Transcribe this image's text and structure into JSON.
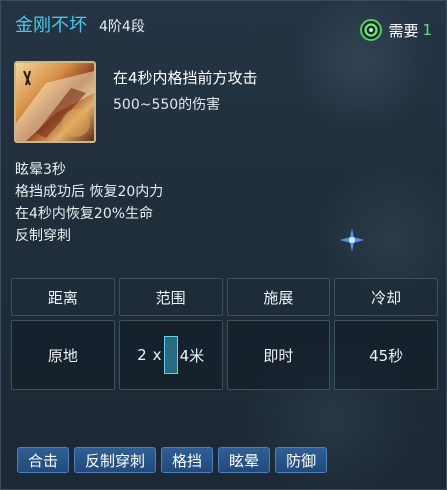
{
  "header": {
    "title": "金刚不坏",
    "stage": "4阶4段",
    "requirement_label": "需要",
    "requirement_value": "1"
  },
  "skill": {
    "icon": "skill-icon",
    "description": "在4秒内格挡前方攻击",
    "damage": "500~550的伤害"
  },
  "effects": [
    "眩晕3秒",
    "格挡成功后 恢复20内力",
    "在4秒内恢复20%生命",
    "反制穿刺"
  ],
  "stats": {
    "headers": [
      "距离",
      "范围",
      "施展",
      "冷却"
    ],
    "distance": "原地",
    "range_left": "2",
    "range_x": "x",
    "range_right": "4米",
    "cast": "即时",
    "cooldown": "45秒"
  },
  "tags": [
    "合击",
    "反制穿刺",
    "格挡",
    "眩晕",
    "防御"
  ],
  "colors": {
    "title": "#45c9ea",
    "requirement_value": "#5fe07a",
    "tag_background": "#2a5586"
  }
}
